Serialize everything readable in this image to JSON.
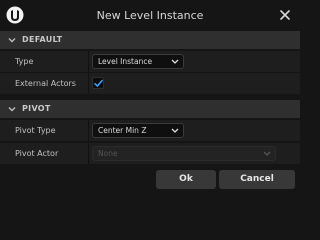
{
  "dialog": {
    "title": "New Level Instance",
    "icons": {
      "app": "unreal-engine-logo-icon",
      "close": "close-icon"
    }
  },
  "sections": {
    "default": {
      "header": "DEFAULT",
      "type_label": "Type",
      "type_value": "Level Instance",
      "external_actors_label": "External Actors",
      "external_actors_checked": true
    },
    "pivot": {
      "header": "PIVOT",
      "pivot_type_label": "Pivot Type",
      "pivot_type_value": "Center Min Z",
      "pivot_actor_label": "Pivot Actor",
      "pivot_actor_value": "None"
    }
  },
  "buttons": {
    "ok": "Ok",
    "cancel": "Cancel"
  },
  "colors": {
    "window_bg": "#151515",
    "section_header_bg": "#2f2f2f",
    "row_bg": "#1e1e1e",
    "checkmark": "#3aa0ff",
    "button_bg": "#383838"
  }
}
